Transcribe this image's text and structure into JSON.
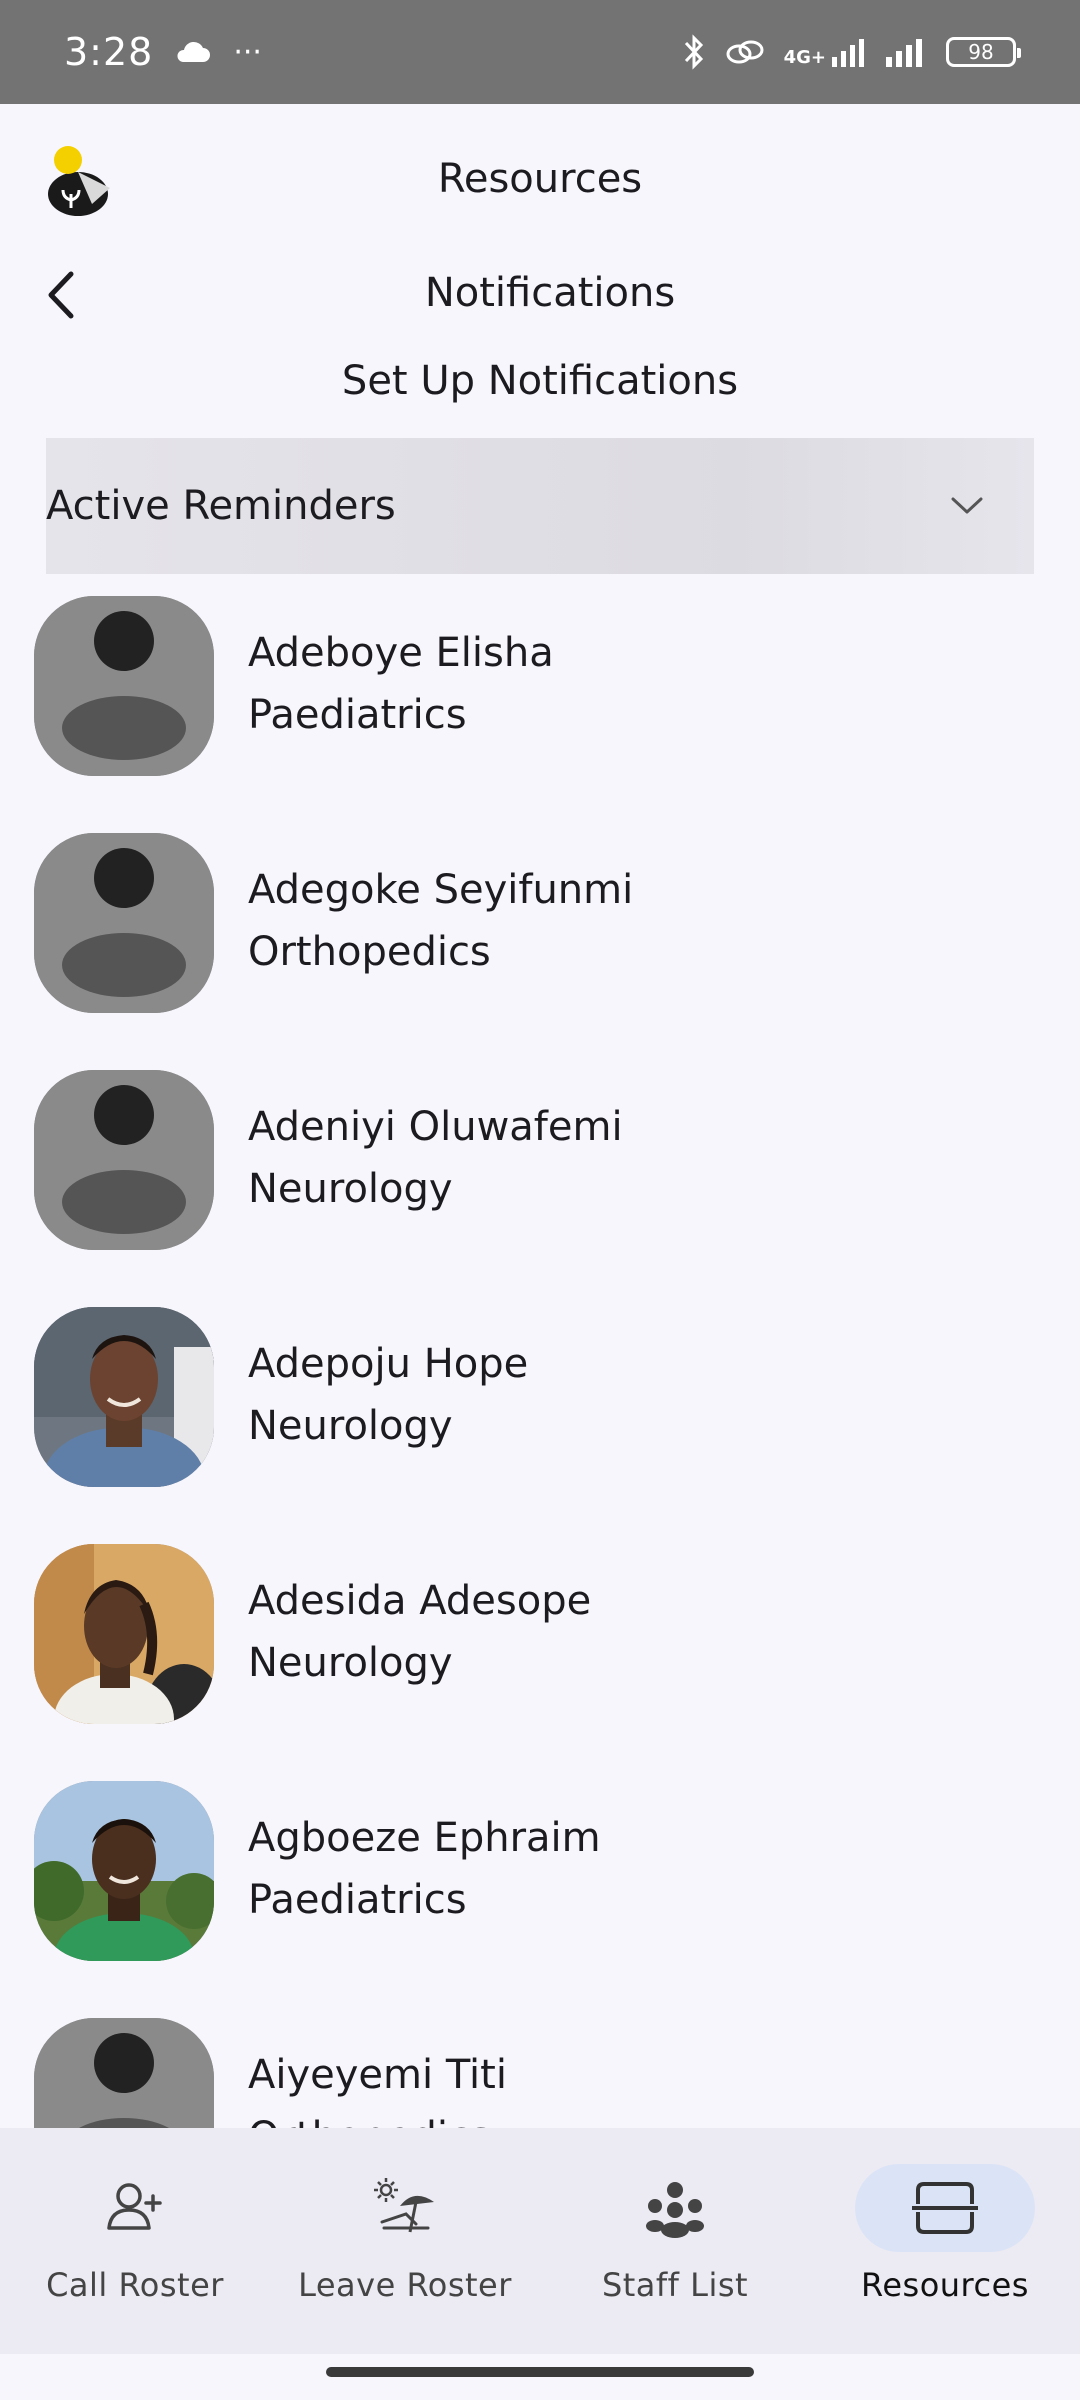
{
  "status_bar": {
    "time": "3:28",
    "more": "···",
    "network": "4G+",
    "battery": "98"
  },
  "header": {
    "title": "Resources"
  },
  "subheader": {
    "title": "Notifications"
  },
  "setup": {
    "title": "Set Up Notifications"
  },
  "dropdown": {
    "label": "Active Reminders"
  },
  "staff": [
    {
      "name": "Adeboye Elisha",
      "department": "Paediatrics",
      "avatar": "placeholder"
    },
    {
      "name": "Adegoke Seyifunmi",
      "department": "Orthopedics",
      "avatar": "placeholder"
    },
    {
      "name": "Adeniyi Oluwafemi",
      "department": "Neurology",
      "avatar": "placeholder"
    },
    {
      "name": "Adepoju Hope",
      "department": "Neurology",
      "avatar": "photo"
    },
    {
      "name": "Adesida Adesope",
      "department": "Neurology",
      "avatar": "photo"
    },
    {
      "name": "Agboeze Ephraim",
      "department": "Paediatrics",
      "avatar": "photo"
    },
    {
      "name": "Aiyeyemi Titi",
      "department": "Orthopedics",
      "avatar": "placeholder"
    }
  ],
  "bottom_nav": [
    {
      "label": "Call Roster",
      "icon": "person-add-icon"
    },
    {
      "label": "Leave Roster",
      "icon": "beach-icon"
    },
    {
      "label": "Staff List",
      "icon": "group-icon"
    },
    {
      "label": "Resources",
      "icon": "resources-icon",
      "active": true
    }
  ],
  "colors": {
    "background": "#f7f6fc",
    "status_bar": "#737373",
    "dropdown": "#dedde3",
    "nav_bar": "#eceaf2",
    "nav_active_pill": "#dbe4f6",
    "avatar_placeholder": "#8a8a8a"
  }
}
